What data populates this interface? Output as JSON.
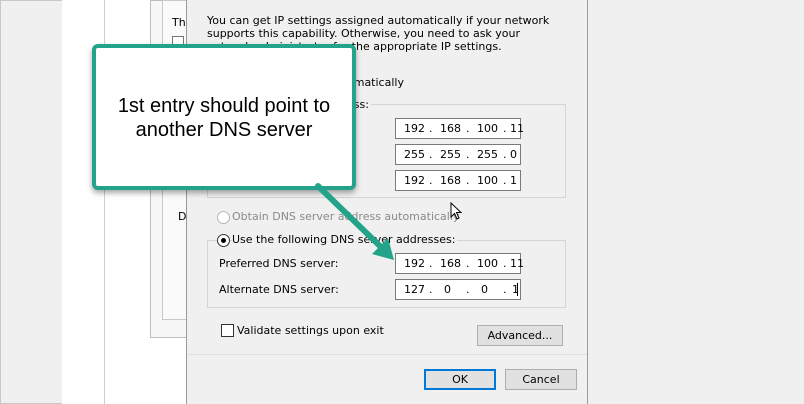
{
  "behind": {
    "label_th": "Th",
    "label_d": "D"
  },
  "dialog": {
    "intro": "You can get IP settings assigned automatically if your network supports this capability. Otherwise, you need to ask your network administrator for the appropriate IP settings.",
    "obtain_ip_auto_partial": "omatically",
    "use_ip_partial": "ess:",
    "ip_address": [
      "192",
      "168",
      "100",
      "11"
    ],
    "subnet_mask": [
      "255",
      "255",
      "255",
      "0"
    ],
    "default_gateway": [
      "192",
      "168",
      "100",
      "1"
    ],
    "obtain_dns_auto": "Obtain DNS server address automatically",
    "use_dns": "Use the following DNS server addresses:",
    "preferred_dns_label": "Preferred DNS server:",
    "preferred_dns": [
      "192",
      "168",
      "100",
      "11"
    ],
    "alternate_dns_label": "Alternate DNS server:",
    "alternate_dns": [
      "127",
      "0",
      "0",
      "1"
    ],
    "validate_label": "Validate settings upon exit",
    "advanced_button": "Advanced...",
    "ok_button": "OK",
    "cancel_button": "Cancel"
  },
  "callout": {
    "text": "1st entry should point to\nanother DNS server",
    "color": "#23a48a"
  },
  "icons": {
    "cursor": "mouse-pointer-icon"
  }
}
